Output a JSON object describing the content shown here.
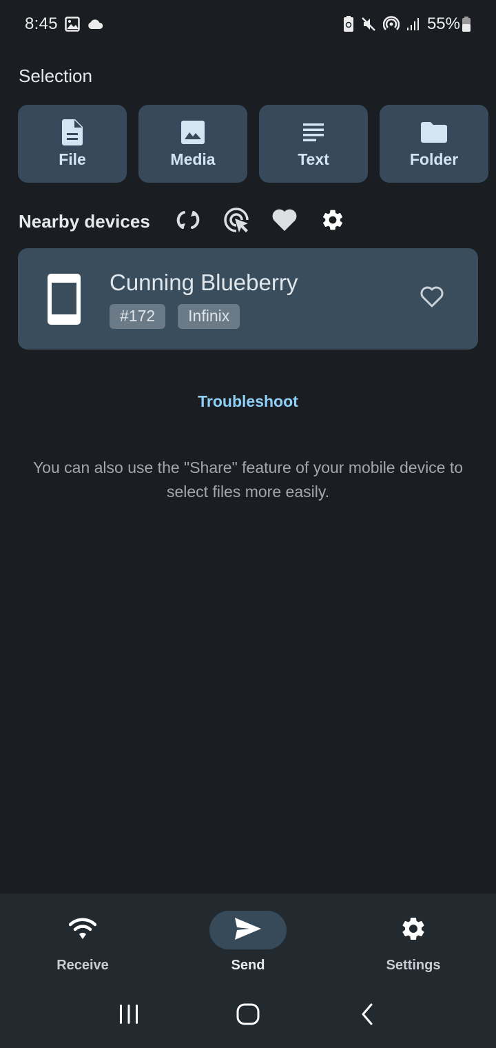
{
  "status_bar": {
    "time": "8:45",
    "left_icons": [
      "gallery-icon",
      "cloud-icon"
    ],
    "right_icons": [
      "battery-saver-icon",
      "mute-icon",
      "hotspot-icon",
      "signal-icon"
    ],
    "battery_percent": "55%"
  },
  "selection": {
    "title": "Selection",
    "tiles": [
      {
        "label": "File",
        "icon": "file-icon"
      },
      {
        "label": "Media",
        "icon": "image-icon"
      },
      {
        "label": "Text",
        "icon": "text-icon"
      },
      {
        "label": "Folder",
        "icon": "folder-icon"
      }
    ]
  },
  "nearby": {
    "title": "Nearby devices",
    "actions": [
      "refresh-icon",
      "target-icon",
      "favorites-icon",
      "settings-icon"
    ]
  },
  "devices": [
    {
      "name": "Cunning Blueberry",
      "badges": [
        "#172",
        "Infinix"
      ],
      "type_icon": "smartphone-icon",
      "favorite": false
    }
  ],
  "troubleshoot_label": "Troubleshoot",
  "hint": "You can also use the \"Share\" feature of your mobile device to select files more easily.",
  "bottom_nav": {
    "items": [
      {
        "label": "Receive",
        "icon": "wifi-icon",
        "active": false
      },
      {
        "label": "Send",
        "icon": "send-icon",
        "active": true
      },
      {
        "label": "Settings",
        "icon": "gear-icon",
        "active": false
      }
    ]
  },
  "colors": {
    "background": "#1a1d21",
    "tile": "#37495a",
    "card": "#3a4d5c",
    "accent_link": "#8fcff7",
    "nav_bg": "#22292f"
  }
}
